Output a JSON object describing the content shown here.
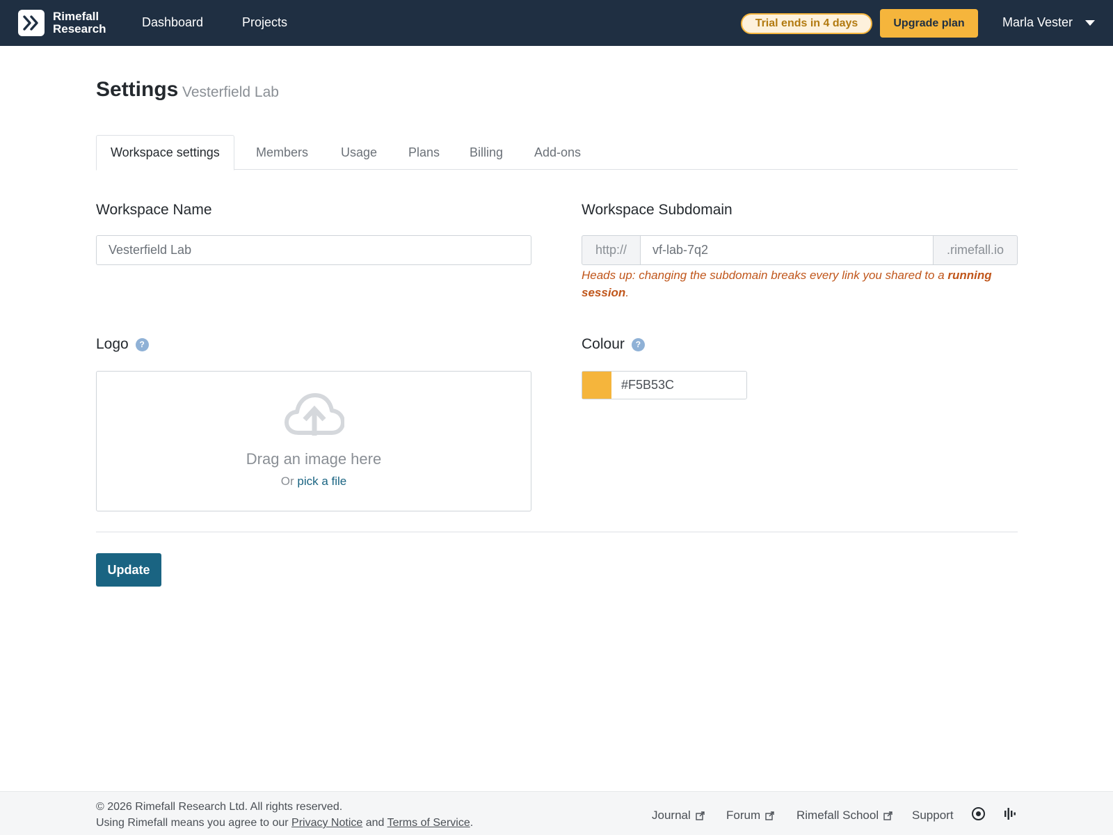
{
  "header": {
    "brand_line1": "Rimefall",
    "brand_line2": "Research",
    "nav": [
      {
        "label": "Dashboard"
      },
      {
        "label": "Projects"
      }
    ],
    "trial_badge": "Trial ends in 4 days",
    "upgrade_label": "Upgrade plan",
    "user_name": "Marla Vester"
  },
  "page": {
    "title": "Settings",
    "subtitle": "Vesterfield Lab"
  },
  "tabs": [
    {
      "label": "Workspace settings",
      "active": true
    },
    {
      "label": "Members"
    },
    {
      "label": "Usage"
    },
    {
      "label": "Plans"
    },
    {
      "label": "Billing"
    },
    {
      "label": "Add-ons"
    }
  ],
  "form": {
    "name_label": "Workspace Name",
    "name_value": "Vesterfield Lab",
    "subdomain_label": "Workspace Subdomain",
    "subdomain_prefix": "http://",
    "subdomain_value": "vf-lab-7q2",
    "subdomain_suffix": ".rimefall.io",
    "warning_text": "Heads up: changing the subdomain breaks every link you shared to a ",
    "warning_bold": "running session",
    "warning_end": ".",
    "logo_label": "Logo",
    "help_glyph": "?",
    "drop_title": "Drag an image here",
    "drop_or": "Or ",
    "drop_link": "pick a file",
    "colour_label": "Colour",
    "colour_value": "#F5B53C",
    "update_label": "Update"
  },
  "colors": {
    "topbar": "#1f2f42",
    "accent": "#f5b53c",
    "primary_button": "#1a6482",
    "warning": "#c0561b"
  },
  "footer": {
    "copyright": "© 2026 Rimefall Research Ltd. All rights reserved.",
    "terms_prefix": "Using Rimefall means you agree to our ",
    "privacy_link": "Privacy Notice",
    "terms_and": " and ",
    "terms_link": "Terms of Service",
    "terms_end": ".",
    "links": [
      {
        "label": "Journal",
        "external": true
      },
      {
        "label": "Forum",
        "external": true
      },
      {
        "label": "Rimefall School",
        "external": true
      },
      {
        "label": "Support",
        "external": false
      }
    ],
    "icons": [
      "status-icon",
      "waveform-icon"
    ]
  }
}
